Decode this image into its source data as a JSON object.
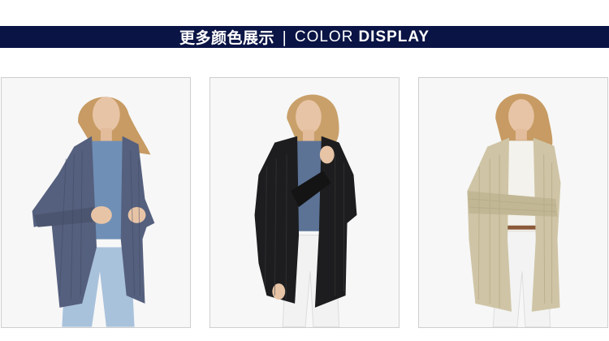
{
  "banner": {
    "title_cn": "更多颜色展示",
    "separator": "|",
    "title_en_light": "COLOR",
    "title_en_bold": "DISPLAY",
    "background": "#0a1445"
  },
  "products": [
    {
      "color_name": "navy-marl",
      "sweater_color": "#55607e",
      "shirt_color": "#6f8fb6",
      "pants_color": "#a9c2dc"
    },
    {
      "color_name": "black",
      "sweater_color": "#1d1d1f",
      "shirt_color": "#5c7396",
      "pants_color": "#f4f4f4"
    },
    {
      "color_name": "oatmeal",
      "sweater_color": "#cfc5a6",
      "shirt_color": "#f4f2ec",
      "pants_color": "#f6f6f6"
    }
  ]
}
